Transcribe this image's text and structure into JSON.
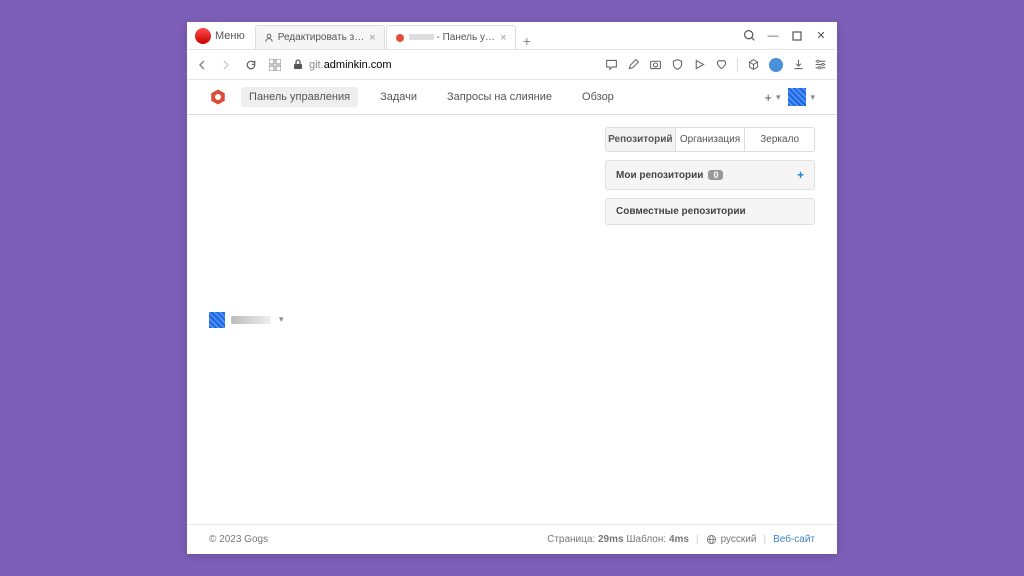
{
  "browser": {
    "menu_label": "Меню",
    "tabs": [
      {
        "title": "Редактировать запись \"У...",
        "icon": "person"
      },
      {
        "title": "- Панель управл",
        "icon": "gogs",
        "active": true
      }
    ],
    "url_prefix": "git.",
    "url_domain": "adminkin.com"
  },
  "window_controls": {
    "search": "⚲",
    "minimize": "—",
    "maximize": "▢",
    "close": "✕"
  },
  "app_nav": [
    {
      "label": "Панель управления",
      "active": true
    },
    {
      "label": "Задачи"
    },
    {
      "label": "Запросы на слияние"
    },
    {
      "label": "Обзор"
    }
  ],
  "user": {
    "name_masked": ""
  },
  "repo_tabs": [
    {
      "label": "Репозиторий",
      "active": true
    },
    {
      "label": "Организация"
    },
    {
      "label": "Зеркало"
    }
  ],
  "panels": {
    "my_repos": {
      "title": "Мои репозитории",
      "count": "0"
    },
    "collab": {
      "title": "Совместные репозитории"
    }
  },
  "footer": {
    "copyright": "© 2023 Gogs",
    "page_label": "Страница:",
    "page_time": "29ms",
    "template_label": "Шаблон:",
    "template_time": "4ms",
    "language": "русский",
    "website": "Веб-сайт"
  }
}
